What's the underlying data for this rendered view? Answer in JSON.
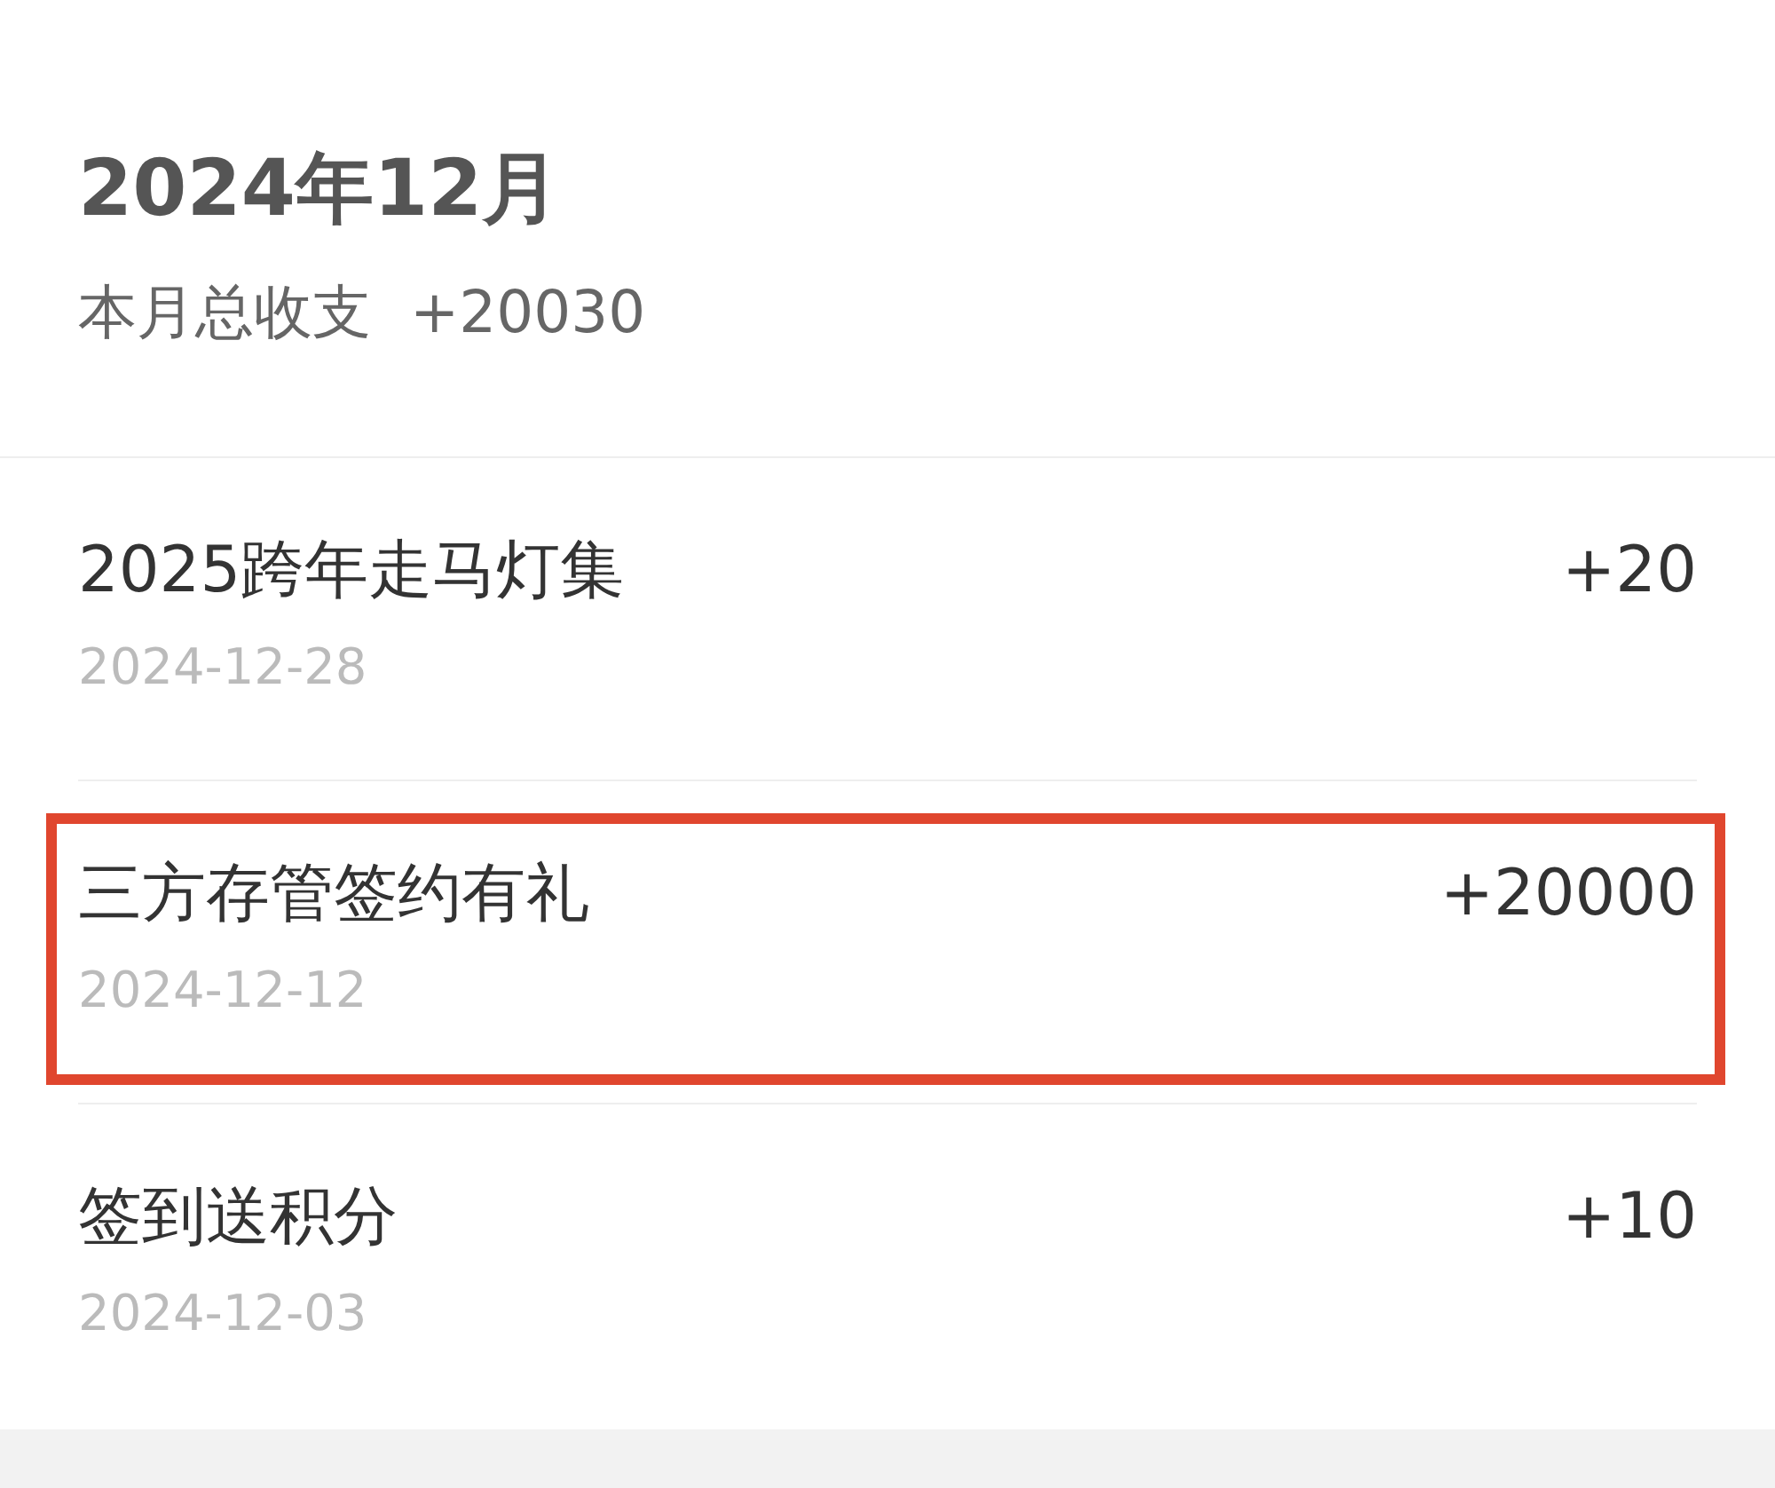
{
  "header": {
    "month": "2024年12月",
    "summary_label": "本月总收支",
    "summary_value": "+20030"
  },
  "records": [
    {
      "title": "2025跨年走马灯集",
      "date": "2024-12-28",
      "amount": "+20",
      "highlighted": false
    },
    {
      "title": "三方存管签约有礼",
      "date": "2024-12-12",
      "amount": "+20000",
      "highlighted": true
    },
    {
      "title": "签到送积分",
      "date": "2024-12-03",
      "amount": "+10",
      "highlighted": false
    }
  ]
}
